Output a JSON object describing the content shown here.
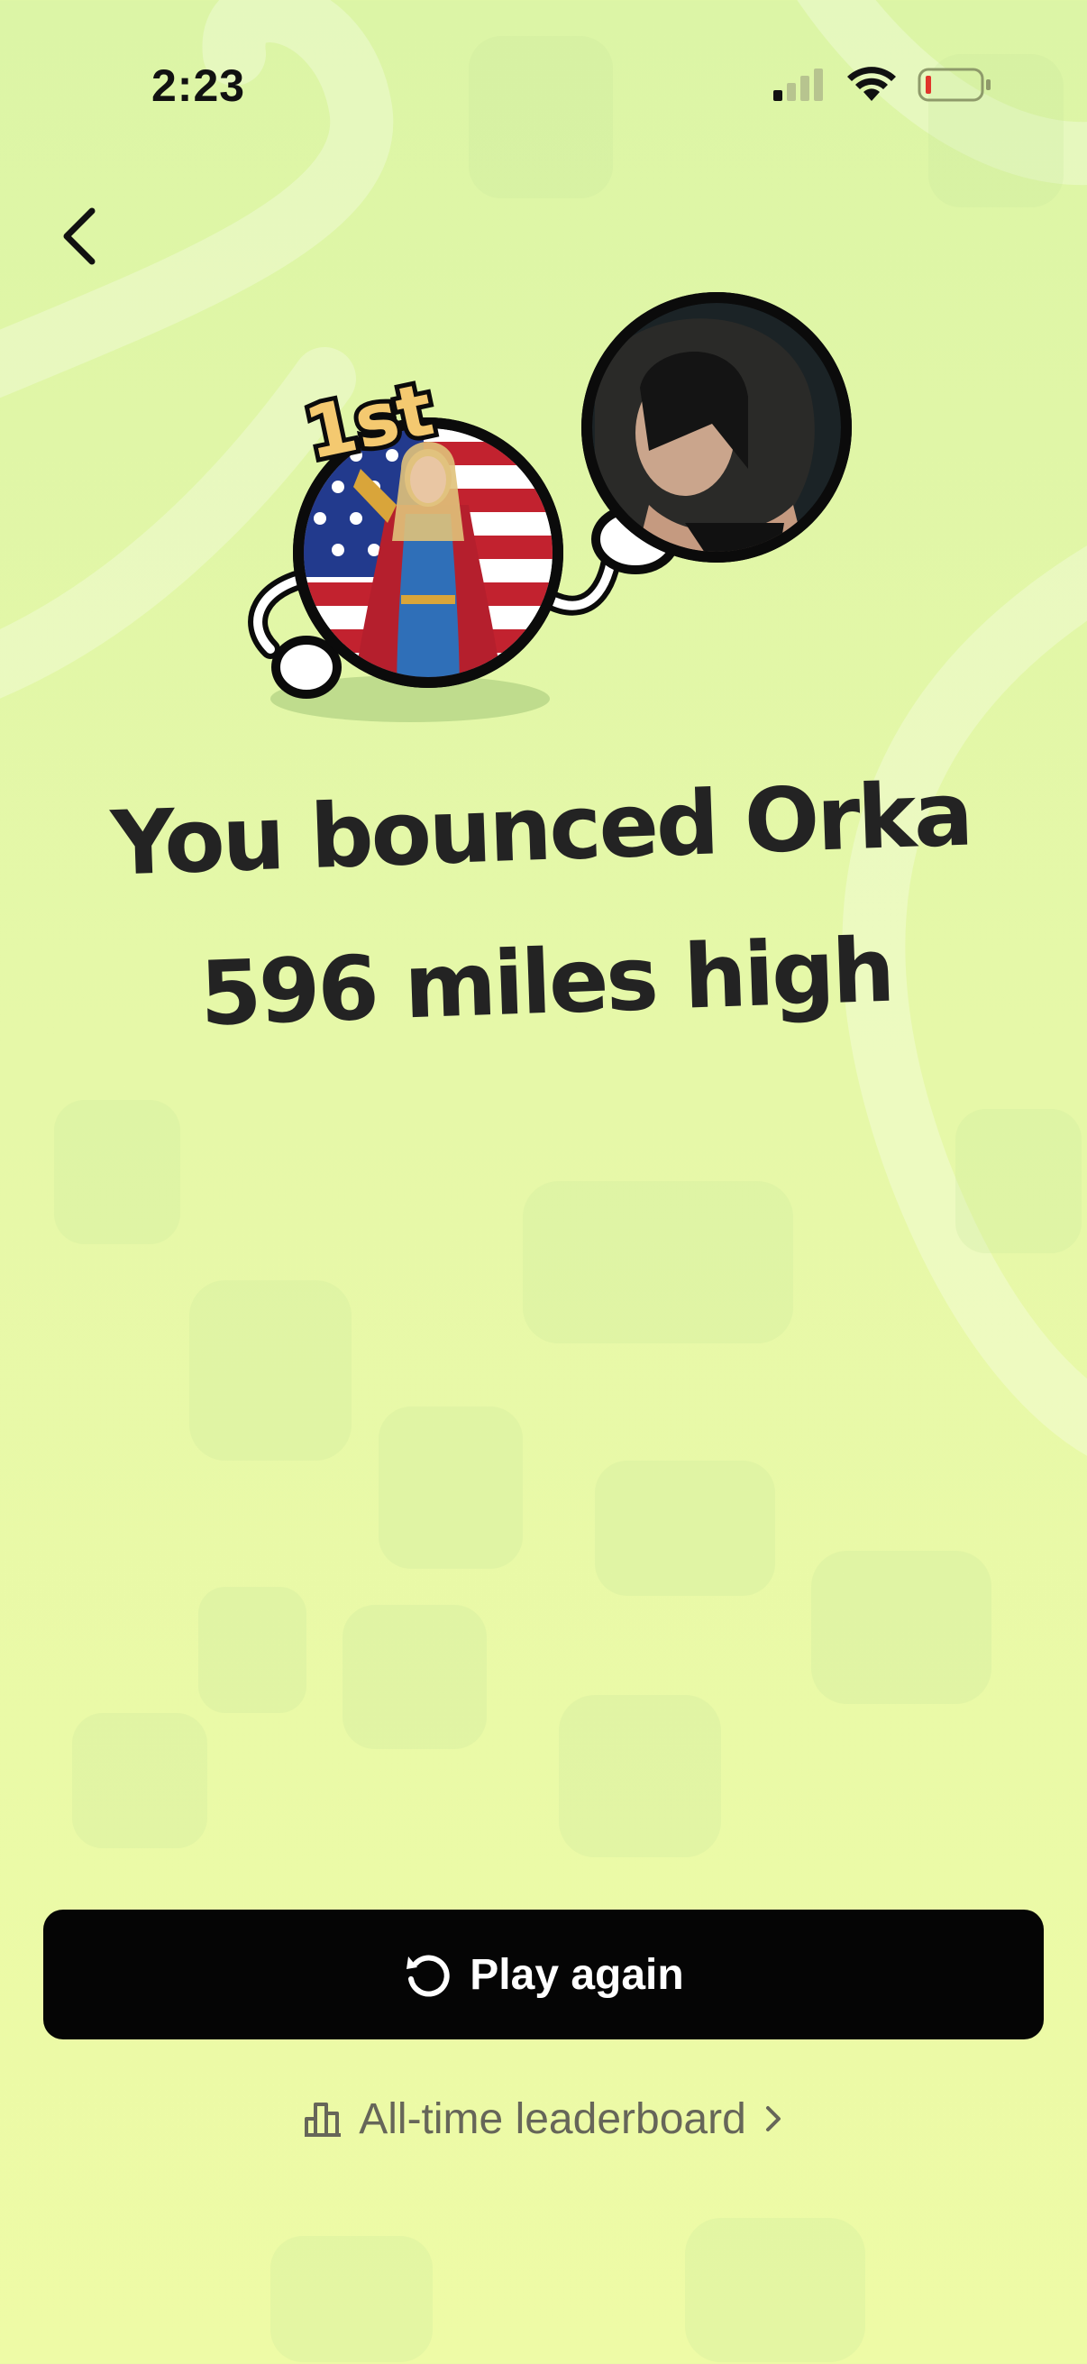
{
  "status_bar": {
    "time": "2:23",
    "icons": [
      "cellular-signal-icon",
      "wifi-icon",
      "battery-low-icon"
    ]
  },
  "nav": {
    "back_icon": "chevron-left-icon"
  },
  "hero": {
    "rank_badge": "1st",
    "avatars": [
      "winner-avatar",
      "opponent-avatar"
    ]
  },
  "result": {
    "line1": "You bounced Orka",
    "line2": "596 miles high"
  },
  "actions": {
    "play_again_label": "Play again",
    "play_again_icon": "replay-icon",
    "leaderboard_label": "All-time leaderboard",
    "leaderboard_icon": "bar-chart-icon",
    "leaderboard_chevron": "chevron-right-icon"
  },
  "colors": {
    "background_top": "#dcf5a6",
    "background_bottom": "#eefba6",
    "text_primary": "#232323",
    "button_bg": "#050505",
    "button_text": "#ffffff",
    "link_text": "#666659",
    "badge_fill": "#f4c970",
    "battery_low": "#e0352b"
  }
}
